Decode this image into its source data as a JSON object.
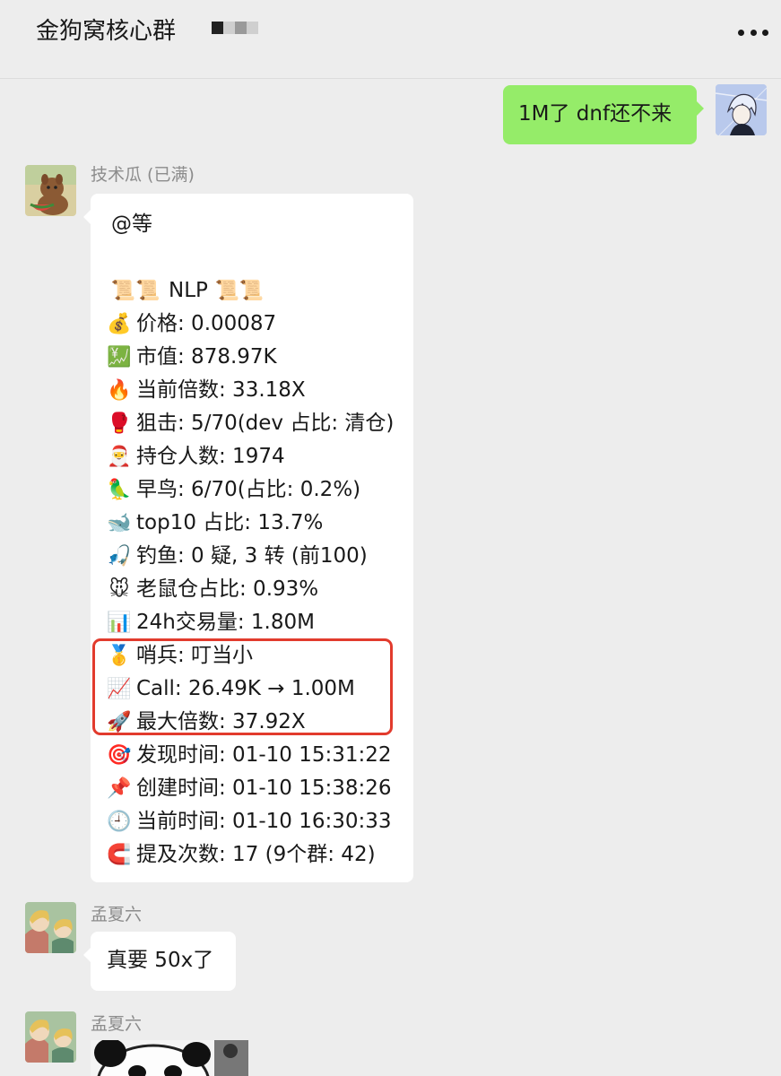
{
  "header": {
    "title": "金狗窝核心群",
    "badge_colors": [
      "#222222",
      "#cfcfcf",
      "#9a9a9a"
    ]
  },
  "messages": [
    {
      "self": true,
      "text": "1M了 dnf还不来"
    },
    {
      "sender": "技术瓜 (已满)",
      "mention": "@等",
      "lines": [
        {
          "emoji": "📜📜",
          "text": "NLP",
          "emoji_after": "📜📜"
        },
        {
          "emoji": "💰",
          "text": "价格: 0.00087"
        },
        {
          "emoji": "💹",
          "text": "市值: 878.97K"
        },
        {
          "emoji": "🔥",
          "text": "当前倍数: 33.18X"
        },
        {
          "emoji": "🥊",
          "text": "狙击: 5/70(dev 占比: 清仓)"
        },
        {
          "emoji": "🎅",
          "text": "持仓人数: 1974"
        },
        {
          "emoji": "🦜",
          "text": "早鸟: 6/70(占比: 0.2%)"
        },
        {
          "emoji": "🐋",
          "text": "top10 占比: 13.7%"
        },
        {
          "emoji": "🎣",
          "text": "钓鱼: 0 疑, 3 转 (前100)"
        },
        {
          "emoji": "🐭",
          "text": "老鼠仓占比: 0.93%"
        },
        {
          "emoji": "📊",
          "text": "24h交易量: 1.80M"
        },
        {
          "emoji": "🥇",
          "text": "哨兵: 叮当小"
        },
        {
          "emoji": "📈",
          "text": "Call: 26.49K → 1.00M"
        },
        {
          "emoji": "🚀",
          "text": "最大倍数: 37.92X"
        },
        {
          "emoji": "🎯",
          "text": "发现时间: 01-10 15:31:22"
        },
        {
          "emoji": "📌",
          "text": "创建时间: 01-10 15:38:26"
        },
        {
          "emoji": "🕘",
          "text": "当前时间: 01-10 16:30:33"
        },
        {
          "emoji": "🧲",
          "text": "提及次数: 17 (9个群: 42)"
        }
      ]
    },
    {
      "sender": "孟夏六",
      "text": "真要 50x了"
    },
    {
      "sender": "孟夏六",
      "image": "panda-meme"
    }
  ],
  "colors": {
    "background": "#ededed",
    "self_bubble": "#95ec69",
    "other_bubble": "#ffffff",
    "highlight_box": "#e23b2d",
    "sender_name": "#8c8c8c"
  }
}
